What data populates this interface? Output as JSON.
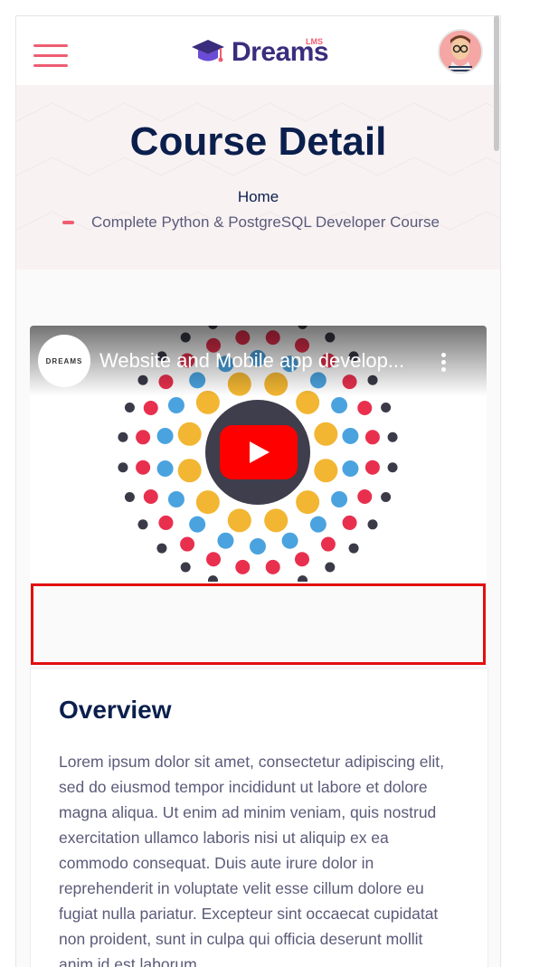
{
  "header": {
    "logo_text": "Dreams",
    "logo_sup": "LMS"
  },
  "banner": {
    "title": "Course Detail",
    "breadcrumb_home": "Home",
    "breadcrumb_current": "Complete Python & PostgreSQL Developer Course"
  },
  "video": {
    "channel_badge": "DREAMS",
    "title": "Website and Mobile app develop..."
  },
  "overview": {
    "title": "Overview",
    "body": "Lorem ipsum dolor sit amet, consectetur adipiscing elit, sed do eiusmod tempor incididunt ut labore et dolore magna aliqua. Ut enim ad minim veniam, quis nostrud exercitation ullamco laboris nisi ut aliquip ex ea commodo consequat. Duis aute irure dolor in reprehenderit in voluptate velit esse cillum dolore eu fugiat nulla pariatur. Excepteur sint occaecat cupidatat non proident, sunt in culpa qui officia deserunt mollit anim id est laborum."
  },
  "colors": {
    "accent": "#ee5d72",
    "navy": "#0b1f4d",
    "brand_purple": "#3b2d7d",
    "youtube_red": "#ff0000"
  }
}
